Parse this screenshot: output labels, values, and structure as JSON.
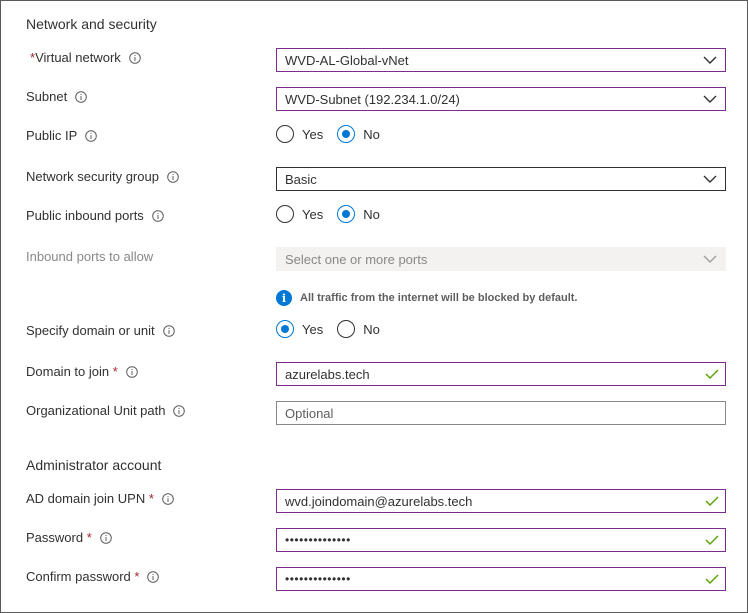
{
  "network": {
    "title": "Network and security",
    "virtual_network": {
      "required_mark": "*",
      "label": "Virtual network",
      "value": "WVD-AL-Global-vNet"
    },
    "subnet": {
      "label": "Subnet",
      "value": "WVD-Subnet (192.234.1.0/24)"
    },
    "public_ip": {
      "label": "Public IP",
      "yes": "Yes",
      "no": "No",
      "selected": "No"
    },
    "nsg": {
      "label": "Network security group",
      "value": "Basic"
    },
    "public_inbound": {
      "label": "Public inbound ports",
      "yes": "Yes",
      "no": "No",
      "selected": "No"
    },
    "inbound_allow": {
      "label": "Inbound ports to allow",
      "placeholder": "Select one or more ports"
    },
    "note": "All traffic from the internet will be blocked by default.",
    "domain_or_unit": {
      "label": "Specify domain or unit",
      "yes": "Yes",
      "no": "No",
      "selected": "Yes"
    },
    "domain_join": {
      "label": "Domain to join",
      "required_mark": "*",
      "value": "azurelabs.tech"
    },
    "ou_path": {
      "label": "Organizational Unit path",
      "placeholder": "Optional"
    }
  },
  "admin": {
    "title": "Administrator account",
    "upn": {
      "label": "AD domain join UPN",
      "required_mark": "*",
      "value": "wvd.joindomain@azurelabs.tech"
    },
    "password": {
      "label": "Password",
      "required_mark": "*",
      "value": "••••••••••••••"
    },
    "confirm": {
      "label": "Confirm password",
      "required_mark": "*",
      "value": "••••••••••••••"
    }
  },
  "colors": {
    "accent": "#0078d4",
    "valid_border": "#7b2d8b",
    "valid_check": "#57a300",
    "required": "#a4262c"
  },
  "icons": [
    "info-icon",
    "chevron-down-icon",
    "checkmark-icon"
  ]
}
